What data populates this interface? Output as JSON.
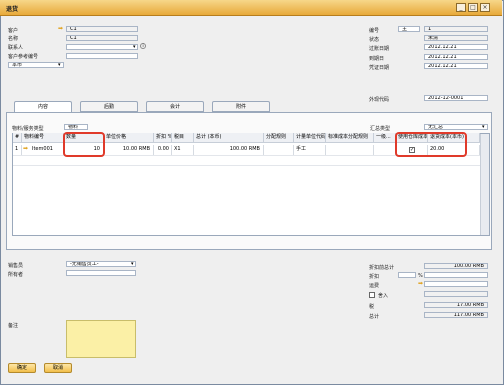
{
  "window": {
    "title": "退货"
  },
  "header_left": {
    "customer_label": "客户",
    "customer_value": "C1",
    "name_label": "名称",
    "name_value": "C1",
    "contact_label": "联系人",
    "contact_value": "",
    "ref_label": "客户参考编号",
    "ref_value": "",
    "currency_label": "本币"
  },
  "header_right": {
    "number_label": "编号",
    "number_series": "主",
    "number_value": "1",
    "status_label": "状态",
    "status_value": "未清",
    "posting_label": "过账日期",
    "posting_value": "2012.12.21",
    "due_label": "到期日",
    "due_value": "2012.12.21",
    "doc_date_label": "凭证日期",
    "doc_date_value": "2012.12.21",
    "ext_label": "外现代码",
    "ext_value": "2012-12-0001"
  },
  "tabs": [
    "内容",
    "后勤",
    "会计",
    "附件"
  ],
  "content": {
    "item_type_label": "物料/服务类型",
    "item_type_value": "物料",
    "summary_type_label": "汇总类型",
    "summary_type_value": "无汇总"
  },
  "grid": {
    "headers": [
      "#",
      "物料编号",
      "数量",
      "单位价格",
      "折扣 %",
      "税目",
      "总计 (本币)",
      "分配规则",
      "计量单位代码",
      "标准成本分配规则",
      "一级...",
      "使用仓库成本",
      "退货成本(本币)"
    ],
    "rows": [
      {
        "num": "1",
        "item": "Item001",
        "qty": "10",
        "price": "10.00 RMB",
        "discount": "0.00",
        "tax": "X1",
        "total": "100.00 RMB",
        "rule": "",
        "uom": "手工",
        "std": "",
        "level": "",
        "use_whse": "✓",
        "return_cost": "20.00"
      }
    ]
  },
  "footer_left": {
    "sales_label": "销售员",
    "sales_value": "-无销售员工-",
    "owner_label": "所有者",
    "owner_value": "",
    "remarks_label": "备注"
  },
  "footer_right": {
    "before_disc_label": "折扣前总计",
    "before_disc_value": "100.00 RMB",
    "discount_label": "折扣",
    "discount_pct": "%",
    "freight_label": "运费",
    "rounding_label": "舍入",
    "tax_label": "税",
    "tax_value": "17.00 RMB",
    "total_label": "总计",
    "total_value": "117.00 RMB"
  },
  "buttons": {
    "ok": "确定",
    "cancel": "取消"
  }
}
